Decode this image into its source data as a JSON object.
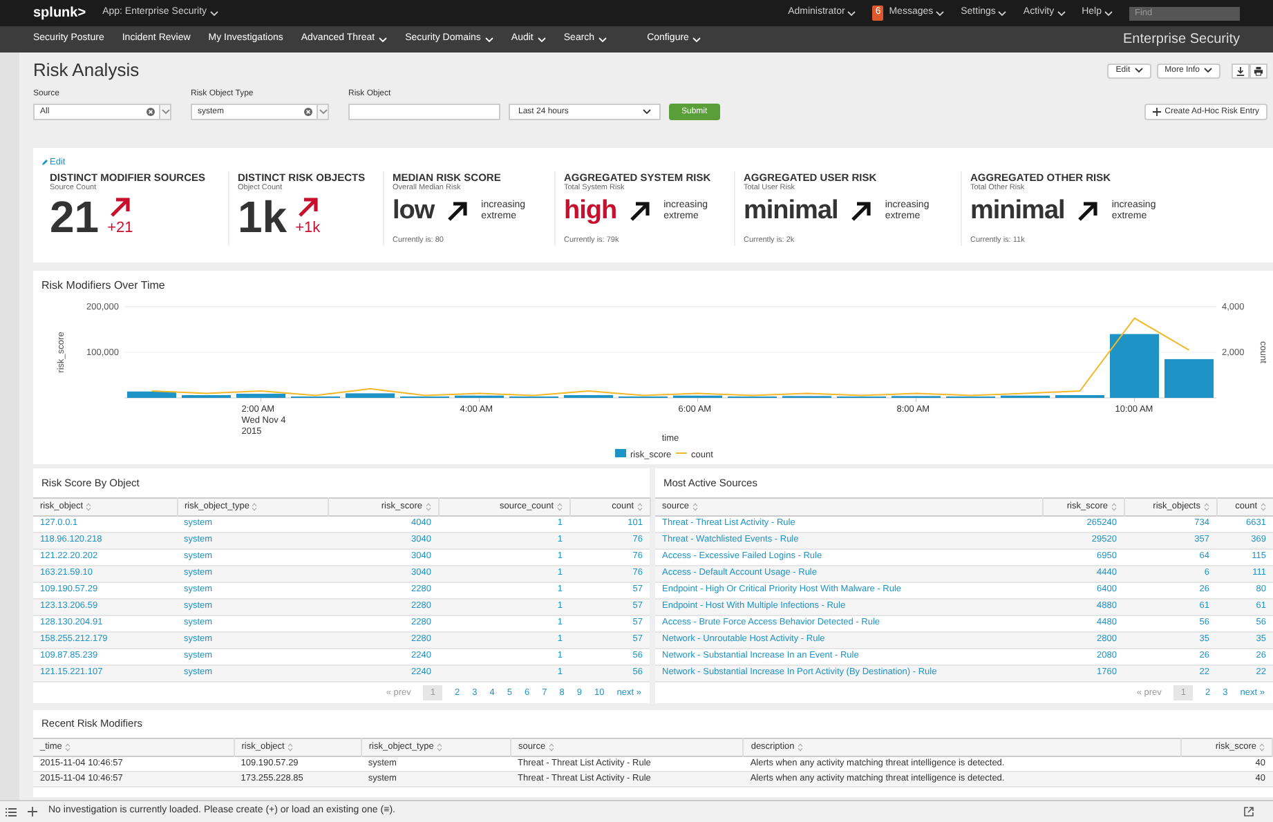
{
  "top_bar": {
    "logo": "splunk>",
    "app": "App: Enterprise Security",
    "menus": [
      {
        "label": "Administrator"
      },
      {
        "label": "Messages",
        "badge": "6"
      },
      {
        "label": "Settings"
      },
      {
        "label": "Activity"
      },
      {
        "label": "Help"
      }
    ],
    "find_placeholder": "Find"
  },
  "nav": {
    "items": [
      {
        "label": "Security Posture",
        "dropdown": false
      },
      {
        "label": "Incident Review",
        "dropdown": false
      },
      {
        "label": "My Investigations",
        "dropdown": false
      },
      {
        "label": "Advanced Threat",
        "dropdown": true
      },
      {
        "label": "Security Domains",
        "dropdown": true
      },
      {
        "label": "Audit",
        "dropdown": true
      },
      {
        "label": "Search",
        "dropdown": true
      },
      {
        "label": "Configure",
        "dropdown": true
      }
    ],
    "app_title": "Enterprise Security"
  },
  "page": {
    "title": "Risk Analysis",
    "buttons": [
      "Edit",
      "More Info"
    ]
  },
  "filters": [
    {
      "kind": "select",
      "label": "Source",
      "value": "All"
    },
    {
      "kind": "select",
      "label": "Risk Object Type",
      "value": "system"
    },
    {
      "kind": "text",
      "label": "Risk Object"
    }
  ],
  "time_picker": "Last 24 hours",
  "submit": "Submit",
  "create_button": "Create Ad-Hoc Risk Entry",
  "kpi_edit": "Edit",
  "kpis": [
    {
      "kind": "delta",
      "title": "DISTINCT MODIFIER SOURCES",
      "subtitle": "Source Count",
      "value": "21",
      "color": "#333333",
      "delta": "+21"
    },
    {
      "kind": "delta",
      "title": "DISTINCT RISK OBJECTS",
      "subtitle": "Object Count",
      "value": "1k",
      "color": "#333333",
      "delta": "+1k"
    },
    {
      "kind": "trend",
      "title": "MEDIAN RISK SCORE",
      "subtitle": "Overall Median Risk",
      "value": "low",
      "color": "#333333",
      "trend": "increasing extreme",
      "current": "Currently is: 80"
    },
    {
      "kind": "trend",
      "title": "AGGREGATED SYSTEM RISK",
      "subtitle": "Total System Risk",
      "value": "high",
      "color": "#c8102e",
      "trend": "increasing extreme",
      "current": "Currently is: 79k"
    },
    {
      "kind": "trend",
      "title": "AGGREGATED USER RISK",
      "subtitle": "Total User Risk",
      "value": "minimal",
      "color": "#333333",
      "trend": "increasing extreme",
      "current": "Currently is: 2k"
    },
    {
      "kind": "trend",
      "title": "AGGREGATED OTHER RISK",
      "subtitle": "Total Other Risk",
      "value": "minimal",
      "color": "#333333",
      "trend": "increasing extreme",
      "current": "Currently is: 11k"
    }
  ],
  "chart_panel": {
    "title": "Risk Modifiers Over Time",
    "chart_data": {
      "type": "bar",
      "xlabel": "time",
      "ylabel": "risk_score",
      "y2label": "count",
      "x": [
        1,
        1.5,
        2,
        2.5,
        3,
        3.5,
        4,
        4.5,
        5,
        5.5,
        6,
        6.5,
        7,
        7.5,
        8,
        8.5,
        9,
        9.5,
        10,
        10.5
      ],
      "xlim": [
        0.75,
        10.75
      ],
      "series": [
        {
          "name": "risk_score",
          "type": "bar",
          "color": "#1e93c6",
          "values": [
            14000,
            6000,
            9000,
            3000,
            10000,
            3000,
            5000,
            3000,
            6000,
            3000,
            5000,
            3000,
            4000,
            3000,
            4000,
            3000,
            5000,
            6000,
            140000,
            85000
          ]
        },
        {
          "name": "count",
          "type": "line",
          "axis": "y2",
          "color": "#f2b827",
          "values": [
            300,
            200,
            300,
            100,
            400,
            100,
            200,
            100,
            300,
            100,
            200,
            100,
            200,
            100,
            200,
            100,
            200,
            300,
            3500,
            2100
          ]
        }
      ],
      "ylim": [
        0,
        200000
      ],
      "y2lim": [
        0,
        4000
      ],
      "legend": true,
      "yticks": [
        {
          "value": 100000,
          "label": "100,000"
        },
        {
          "value": 200000,
          "label": "200,000"
        }
      ],
      "y2ticks": [
        {
          "value": 2000,
          "label": "2,000"
        },
        {
          "value": 4000,
          "label": "4,000"
        }
      ],
      "xticks": [
        {
          "value": 2,
          "label": "2:00 AM\nWed Nov 4\n2015"
        },
        {
          "value": 4,
          "label": "4:00 AM"
        },
        {
          "value": 6,
          "label": "6:00 AM"
        },
        {
          "value": 8,
          "label": "8:00 AM"
        },
        {
          "value": 10,
          "label": "10:00 AM"
        }
      ]
    }
  },
  "risk_by_object": {
    "title": "Risk Score By Object",
    "columns": [
      {
        "label": "risk_object"
      },
      {
        "label": "risk_object_type"
      },
      {
        "label": "risk_score"
      },
      {
        "label": "source_count"
      },
      {
        "label": "count"
      }
    ],
    "rows": [
      [
        "127.0.0.1",
        "system",
        "4040",
        "1",
        "101"
      ],
      [
        "118.96.120.218",
        "system",
        "3040",
        "1",
        "76"
      ],
      [
        "121.22.20.202",
        "system",
        "3040",
        "1",
        "76"
      ],
      [
        "163.21.59.10",
        "system",
        "3040",
        "1",
        "76"
      ],
      [
        "109.190.57.29",
        "system",
        "2280",
        "1",
        "57"
      ],
      [
        "123.13.206.59",
        "system",
        "2280",
        "1",
        "57"
      ],
      [
        "128.130.204.91",
        "system",
        "2280",
        "1",
        "57"
      ],
      [
        "158.255.212.179",
        "system",
        "2280",
        "1",
        "57"
      ],
      [
        "109.87.85.239",
        "system",
        "2240",
        "1",
        "56"
      ],
      [
        "121.15.221.107",
        "system",
        "2240",
        "1",
        "56"
      ]
    ],
    "pager": {
      "prev": "« prev",
      "next": "next »",
      "pages": [
        {
          "label": "1",
          "selected": true
        },
        {
          "label": "2",
          "selected": false
        },
        {
          "label": "3",
          "selected": false
        },
        {
          "label": "4",
          "selected": false
        },
        {
          "label": "5",
          "selected": false
        },
        {
          "label": "6",
          "selected": false
        },
        {
          "label": "7",
          "selected": false
        },
        {
          "label": "8",
          "selected": false
        },
        {
          "label": "9",
          "selected": false
        },
        {
          "label": "10",
          "selected": false
        }
      ]
    }
  },
  "most_active_sources": {
    "title": "Most Active Sources",
    "columns": [
      {
        "label": "source"
      },
      {
        "label": "risk_score"
      },
      {
        "label": "risk_objects"
      },
      {
        "label": "count"
      }
    ],
    "rows": [
      [
        "Threat - Threat List Activity - Rule",
        "265240",
        "734",
        "6631"
      ],
      [
        "Threat - Watchlisted Events - Rule",
        "29520",
        "357",
        "369"
      ],
      [
        "Access - Excessive Failed Logins - Rule",
        "6950",
        "64",
        "115"
      ],
      [
        "Access - Default Account Usage - Rule",
        "4440",
        "6",
        "111"
      ],
      [
        "Endpoint - High Or Critical Priority Host With Malware - Rule",
        "6400",
        "26",
        "80"
      ],
      [
        "Endpoint - Host With Multiple Infections - Rule",
        "4880",
        "61",
        "61"
      ],
      [
        "Access - Brute Force Access Behavior Detected - Rule",
        "4480",
        "56",
        "56"
      ],
      [
        "Network - Unroutable Host Activity - Rule",
        "2800",
        "35",
        "35"
      ],
      [
        "Network - Substantial Increase In an Event - Rule",
        "2080",
        "26",
        "26"
      ],
      [
        "Network - Substantial Increase In Port Activity (By Destination) - Rule",
        "1760",
        "22",
        "22"
      ]
    ],
    "pager": {
      "prev": "« prev",
      "next": "next »",
      "pages": [
        {
          "label": "1",
          "selected": true
        },
        {
          "label": "2",
          "selected": false
        },
        {
          "label": "3",
          "selected": false
        }
      ]
    }
  },
  "recent_risk_modifiers": {
    "title": "Recent Risk Modifiers",
    "columns": [
      {
        "label": "_time"
      },
      {
        "label": "risk_object"
      },
      {
        "label": "risk_object_type"
      },
      {
        "label": "source"
      },
      {
        "label": "description"
      },
      {
        "label": "risk_score"
      }
    ],
    "rows": [
      [
        "2015-11-04 10:46:57",
        "109.190.57.29",
        "system",
        "Threat - Threat List Activity - Rule",
        "Alerts when any activity matching threat intelligence is detected.",
        "40"
      ],
      [
        "2015-11-04 10:46:57",
        "173.255.228.85",
        "system",
        "Threat - Threat List Activity - Rule",
        "Alerts when any activity matching threat intelligence is detected.",
        "40"
      ]
    ]
  },
  "status_bar": {
    "message": "No investigation is currently loaded. Please create (+) or load an existing one (≡)."
  }
}
